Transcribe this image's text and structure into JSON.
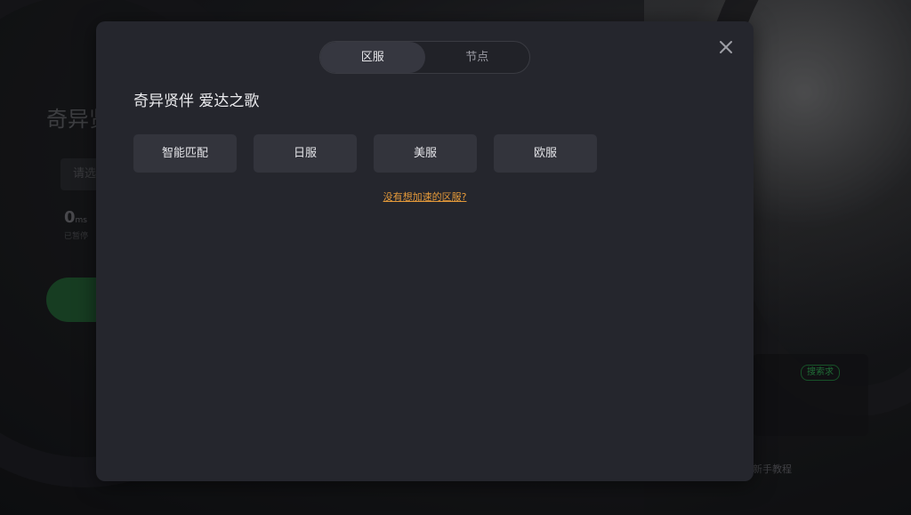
{
  "background": {
    "title": "奇异贤",
    "select_placeholder": "请选",
    "ping_value": "0",
    "ping_unit": "ms",
    "ping_sub": "已暂停",
    "tag": "搜索求",
    "link": "新手教程"
  },
  "modal": {
    "tabs": [
      {
        "label": "区服",
        "active": true
      },
      {
        "label": "节点",
        "active": false
      }
    ],
    "game_title": "奇异贤伴 爱达之歌",
    "regions": [
      {
        "label": "智能匹配"
      },
      {
        "label": "日服"
      },
      {
        "label": "美服"
      },
      {
        "label": "欧服"
      }
    ],
    "missing_region_link": "没有想加速的区服?"
  },
  "colors": {
    "modal_bg": "#25262d",
    "accent_link": "#e59a3a",
    "tab_active_bg": "#363740"
  }
}
